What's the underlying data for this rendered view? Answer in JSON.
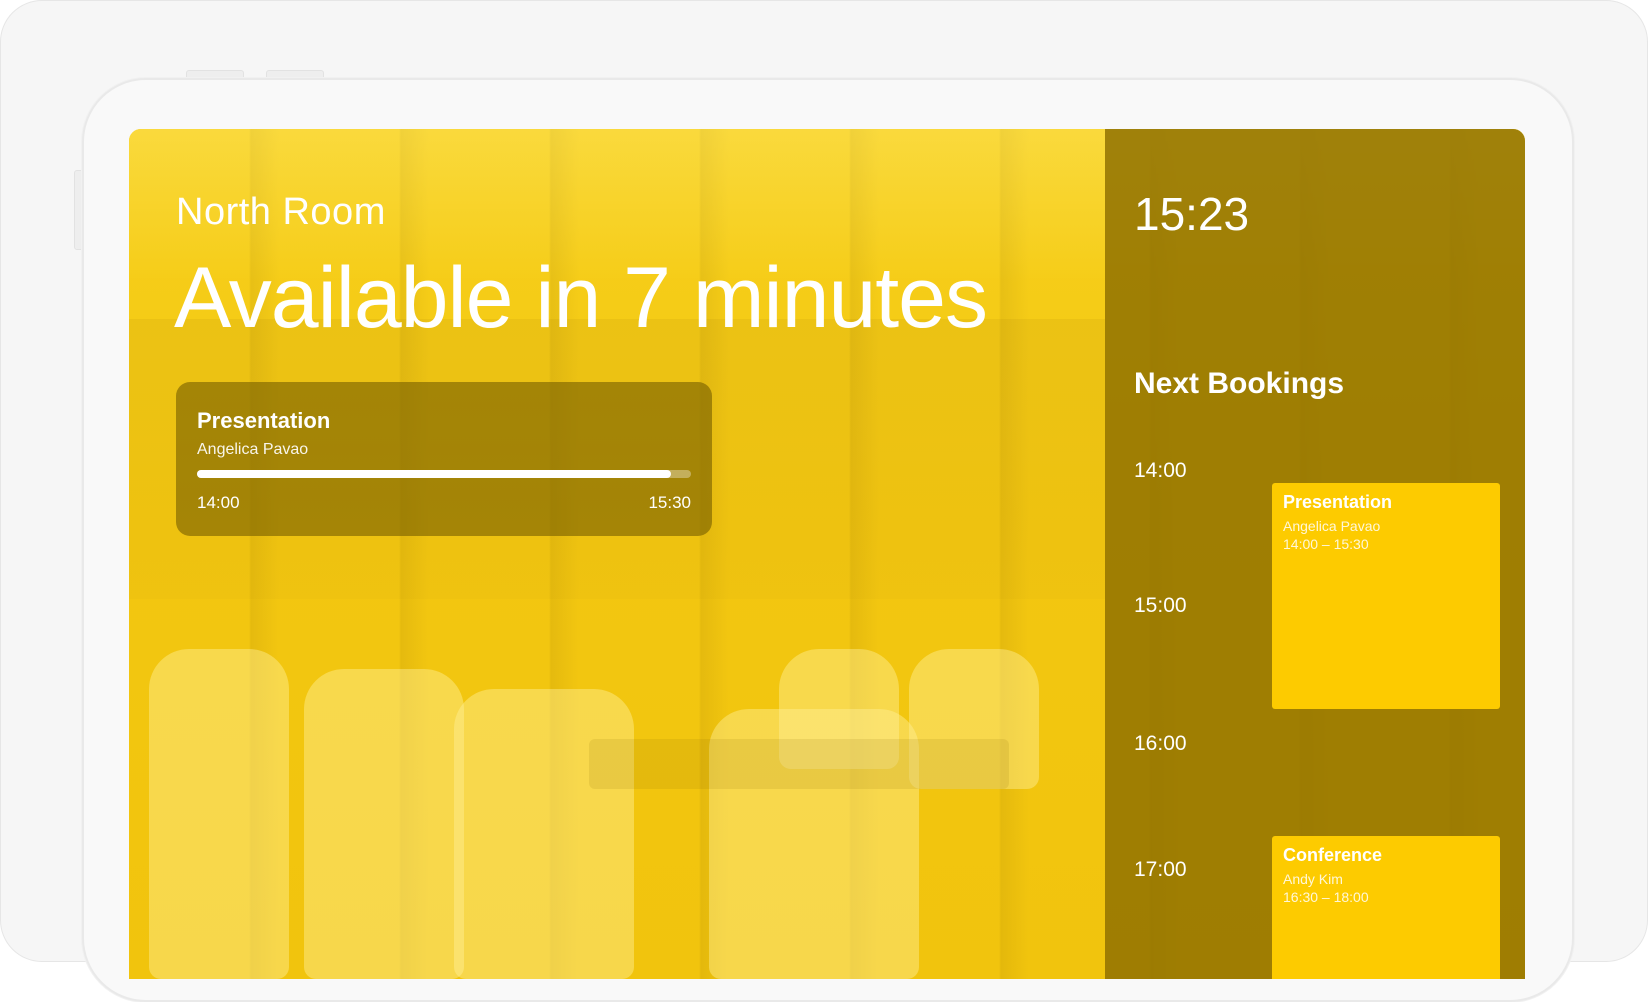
{
  "room": {
    "name": "North Room",
    "status": "Available in 7 minutes"
  },
  "current_meeting": {
    "title": "Presentation",
    "owner": "Angelica Pavao",
    "start": "14:00",
    "end": "15:30",
    "progress_fraction": 0.96
  },
  "sidebar": {
    "clock": "15:23",
    "heading": "Next Bookings",
    "hours": [
      "14:00",
      "15:00",
      "16:00",
      "17:00"
    ],
    "bookings": [
      {
        "title": "Presentation",
        "owner": "Angelica Pavao",
        "time": "14:00 – 15:30"
      },
      {
        "title": "Conference",
        "owner": "Andy Kim",
        "time": "16:30 – 18:00"
      }
    ]
  },
  "colors": {
    "accent": "#fdcb00",
    "background": "#f5c80f",
    "sidebar": "#8c6e00"
  }
}
